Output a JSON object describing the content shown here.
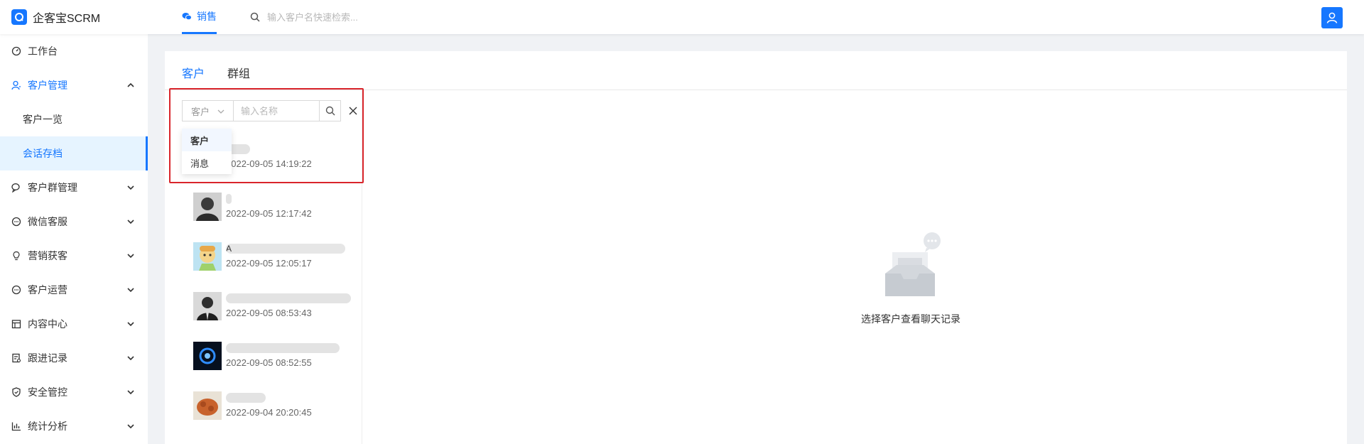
{
  "colors": {
    "accent": "#1677ff",
    "highlight": "#d9252b",
    "active_bg": "#e6f4ff"
  },
  "brand": {
    "name": "企客宝SCRM",
    "icon": "qi-logo-icon"
  },
  "header": {
    "nav_tab": "销售",
    "search_placeholder": "输入客户名快速检索...",
    "user_icon": "user-icon"
  },
  "sidebar": {
    "items": [
      {
        "label": "工作台",
        "icon": "dashboard-icon"
      },
      {
        "label": "客户管理",
        "icon": "customer-icon",
        "expanded": true
      },
      {
        "label": "客户一览"
      },
      {
        "label": "会话存档",
        "active": true
      },
      {
        "label": "客户群管理",
        "icon": "group-chat-icon"
      },
      {
        "label": "微信客服",
        "icon": "wechat-service-icon"
      },
      {
        "label": "营销获客",
        "icon": "bulb-icon"
      },
      {
        "label": "客户运营",
        "icon": "operation-icon"
      },
      {
        "label": "内容中心",
        "icon": "content-icon"
      },
      {
        "label": "跟进记录",
        "icon": "follow-record-icon"
      },
      {
        "label": "安全管控",
        "icon": "shield-icon"
      },
      {
        "label": "统计分析",
        "icon": "bar-chart-icon"
      }
    ]
  },
  "main": {
    "tabs": [
      {
        "label": "客户",
        "active": true
      },
      {
        "label": "群组"
      }
    ],
    "filter": {
      "type_value": "客户",
      "name_placeholder": "输入名称",
      "options": [
        "客户",
        "消息"
      ]
    },
    "conversations": [
      {
        "name": "",
        "time": "2022-09-05 14:19:22"
      },
      {
        "name": "",
        "time": "2022-09-05 12:17:42"
      },
      {
        "name": "A",
        "time": "2022-09-05 12:05:17"
      },
      {
        "name": "",
        "time": "2022-09-05 08:53:43"
      },
      {
        "name": "",
        "time": "2022-09-05 08:52:55"
      },
      {
        "name": "",
        "time": "2022-09-04 20:20:45"
      }
    ],
    "empty_text": "选择客户查看聊天记录"
  }
}
